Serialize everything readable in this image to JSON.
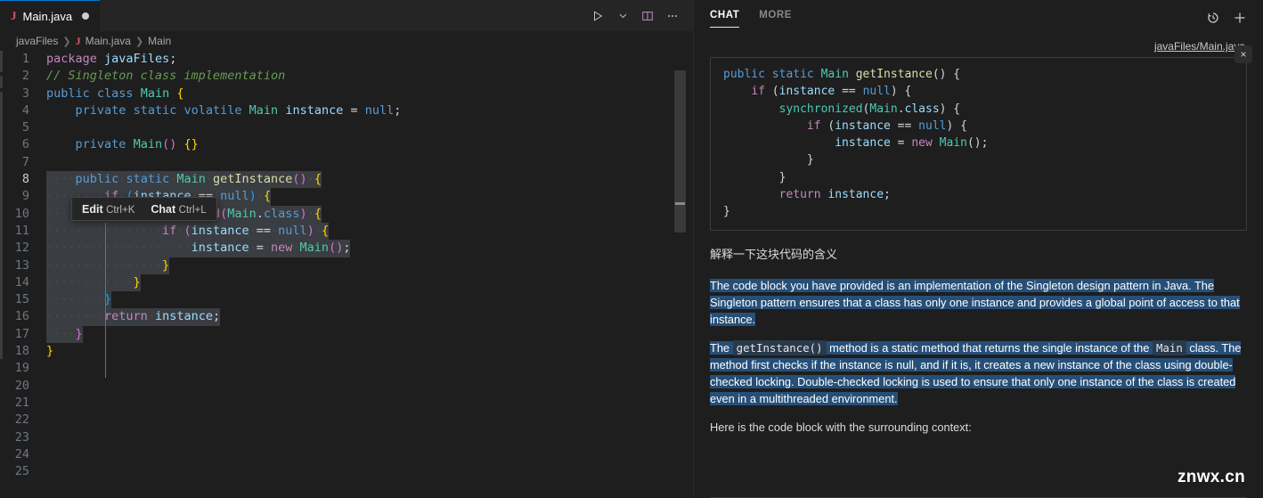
{
  "editor": {
    "tab": {
      "label": "Main.java",
      "icon": "java-icon",
      "dirty": true
    },
    "actions": {
      "run": "run-icon",
      "run_chevron": "chevron-down-icon",
      "split": "split-editor-icon",
      "more": "more-actions-icon"
    },
    "breadcrumb": [
      "javaFiles",
      "Main.java",
      "Main"
    ],
    "hint_widget": {
      "edit_label": "Edit",
      "edit_key": "Ctrl+K",
      "chat_label": "Chat",
      "chat_key": "Ctrl+L"
    },
    "lines": [
      {
        "n": "1",
        "text": "package javaFiles;"
      },
      {
        "n": "2",
        "text": "// Singleton class implementation"
      },
      {
        "n": "3",
        "text": "public class Main {"
      },
      {
        "n": "4",
        "text": "    private static volatile Main instance = null;"
      },
      {
        "n": "5",
        "text": ""
      },
      {
        "n": "6",
        "text": "    private Main() {}"
      },
      {
        "n": "7",
        "text": ""
      },
      {
        "n": "8",
        "text": "    public static Main getInstance() {"
      },
      {
        "n": "9",
        "text": "        if (instance == null) {"
      },
      {
        "n": "10",
        "text": "            synchronized(Main.class) {"
      },
      {
        "n": "11",
        "text": "                if (instance == null) {"
      },
      {
        "n": "12",
        "text": "                    instance = new Main();"
      },
      {
        "n": "13",
        "text": "                }"
      },
      {
        "n": "14",
        "text": "            }"
      },
      {
        "n": "15",
        "text": "        }"
      },
      {
        "n": "16",
        "text": "        return instance;"
      },
      {
        "n": "17",
        "text": "    }"
      },
      {
        "n": "18",
        "text": "}"
      },
      {
        "n": "19",
        "text": ""
      },
      {
        "n": "20",
        "text": ""
      },
      {
        "n": "21",
        "text": ""
      },
      {
        "n": "22",
        "text": ""
      },
      {
        "n": "23",
        "text": ""
      },
      {
        "n": "24",
        "text": ""
      },
      {
        "n": "25",
        "text": ""
      }
    ]
  },
  "chat": {
    "tabs": [
      {
        "label": "CHAT",
        "active": true
      },
      {
        "label": "MORE",
        "active": false
      }
    ],
    "header_actions": {
      "history": "history-icon",
      "new_chat": "plus-icon"
    },
    "context_file": "javaFiles/Main.java",
    "context_close": "×",
    "code_lines": [
      "public static Main getInstance() {",
      "    if (instance == null) {",
      "        synchronized(Main.class) {",
      "            if (instance == null) {",
      "                instance = new Main();",
      "            }",
      "        }",
      "        return instance;",
      "}"
    ],
    "user_message": "解释一下这块代码的含义",
    "answer": {
      "p1": "The code block you have provided is an implementation of the Singleton design pattern in Java. The Singleton pattern ensures that a class has only one instance and provides a global point of access to that instance.",
      "p2_a": "The",
      "p2_code1": "getInstance()",
      "p2_b": "method is a static method that returns the single instance of the",
      "p2_code2": "Main",
      "p2_c": "class. The method first checks if the instance is null, and if it is, it creates a new instance of the class using double-checked locking. Double-checked locking is used to ensure that only one instance of the class is created even in a multithreaded environment.",
      "p3": "Here is the code block with the surrounding context:"
    },
    "watermark": "znwx.cn"
  },
  "colors": {
    "accent": "#0078d4",
    "selection": "#264f78",
    "editor_bg": "#1e1e1e",
    "tabbar_bg": "#252526",
    "java_icon": "#e05561"
  }
}
